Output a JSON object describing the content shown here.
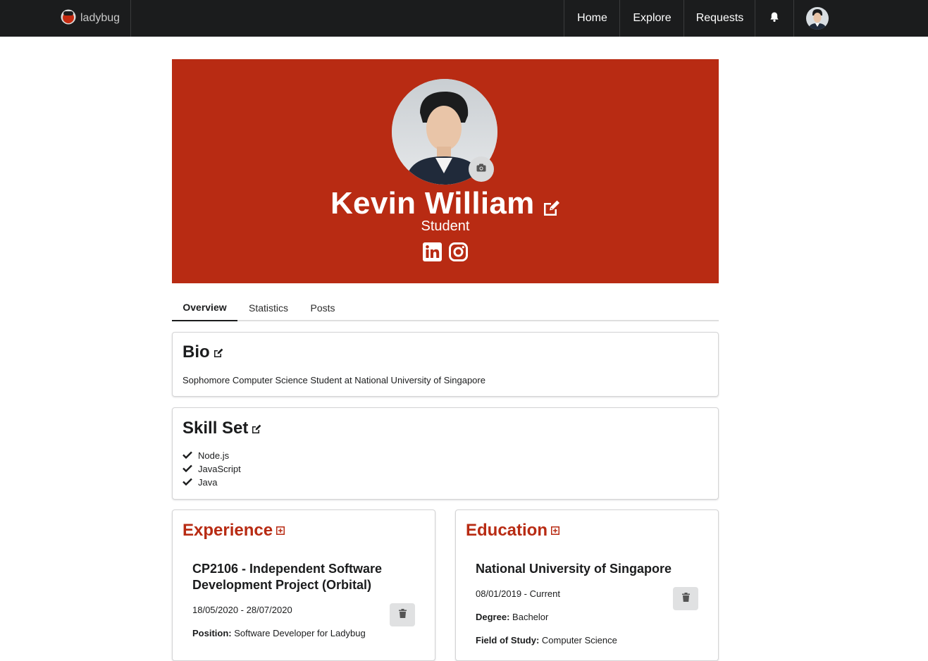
{
  "nav": {
    "brand": "ladybug",
    "items": [
      {
        "label": "Home"
      },
      {
        "label": "Explore"
      },
      {
        "label": "Requests"
      }
    ],
    "icons": {
      "bell": "bell-icon",
      "avatar": "avatar"
    }
  },
  "profile": {
    "name": "Kevin William",
    "role": "Student",
    "socials": [
      "linkedin-icon",
      "instagram-icon"
    ],
    "accent": "#b82b13"
  },
  "tabs": [
    {
      "label": "Overview",
      "active": true
    },
    {
      "label": "Statistics",
      "active": false
    },
    {
      "label": "Posts",
      "active": false
    }
  ],
  "bio": {
    "title": "Bio",
    "text": "Sophomore Computer Science Student at National University of Singapore"
  },
  "skills": {
    "title": "Skill Set",
    "items": [
      "Node.js",
      "JavaScript",
      "Java"
    ]
  },
  "experience": {
    "title": "Experience",
    "entries": [
      {
        "title_line1": "CP2106 - Independent Software",
        "title_line2": "Development Project (Orbital)",
        "dates": "18/05/2020 - 28/07/2020",
        "position_label": "Position:",
        "position_value": "Software Developer for Ladybug"
      }
    ]
  },
  "education": {
    "title": "Education",
    "entries": [
      {
        "school": "National University of Singapore",
        "dates": "08/01/2019 - Current",
        "degree_label": "Degree:",
        "degree_value": "Bachelor",
        "field_label": "Field of Study:",
        "field_value": "Computer Science"
      }
    ]
  }
}
